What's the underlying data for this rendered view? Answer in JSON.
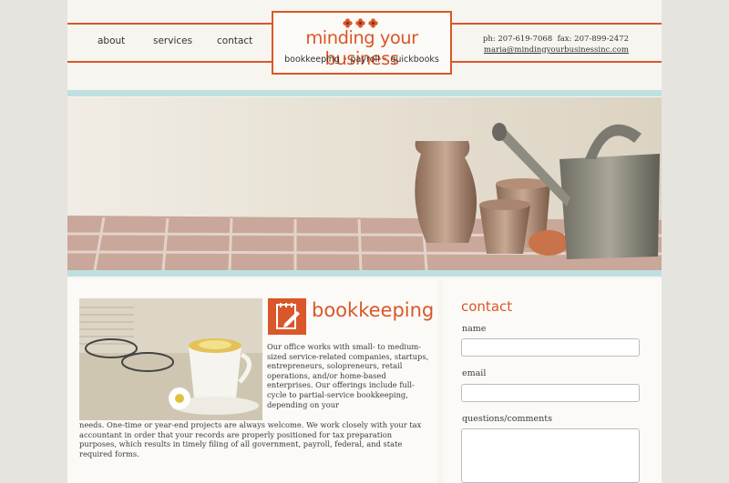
{
  "nav": {
    "items": [
      "about",
      "services",
      "contact"
    ]
  },
  "logo": {
    "name": "minding your business",
    "tagline": [
      "bookkeeping",
      "payroll",
      "quickbooks"
    ],
    "separator": "•"
  },
  "contact_info": {
    "phone": "ph: 207-619-7068",
    "fax": "fax: 207-899-2472",
    "email": "maria@mindingyourbusinessinc.com"
  },
  "main": {
    "title": "bookkeeping",
    "body_wrapped": "Our office works with small- to medium-sized service-related companies, startups, entrepreneurs, solopreneurs, retail operations, and/or home-based enterprises. Our offerings include full-cycle to partial-service bookkeeping, depending on your",
    "body_full": "needs. One-time or year-end projects are always welcome. We work closely with your tax accountant in order that your records are properly positioned for tax preparation purposes, which results in timely filing of all government, payroll, federal, and state required forms."
  },
  "sidebar": {
    "title": "contact",
    "fields": {
      "name": "name",
      "email": "email",
      "comments": "questions/comments"
    }
  },
  "colors": {
    "accent": "#d9572a",
    "teal": "#bfe0e0",
    "background": "#e6e4df"
  },
  "icons": [
    "flower-icon",
    "edit-document-icon"
  ]
}
